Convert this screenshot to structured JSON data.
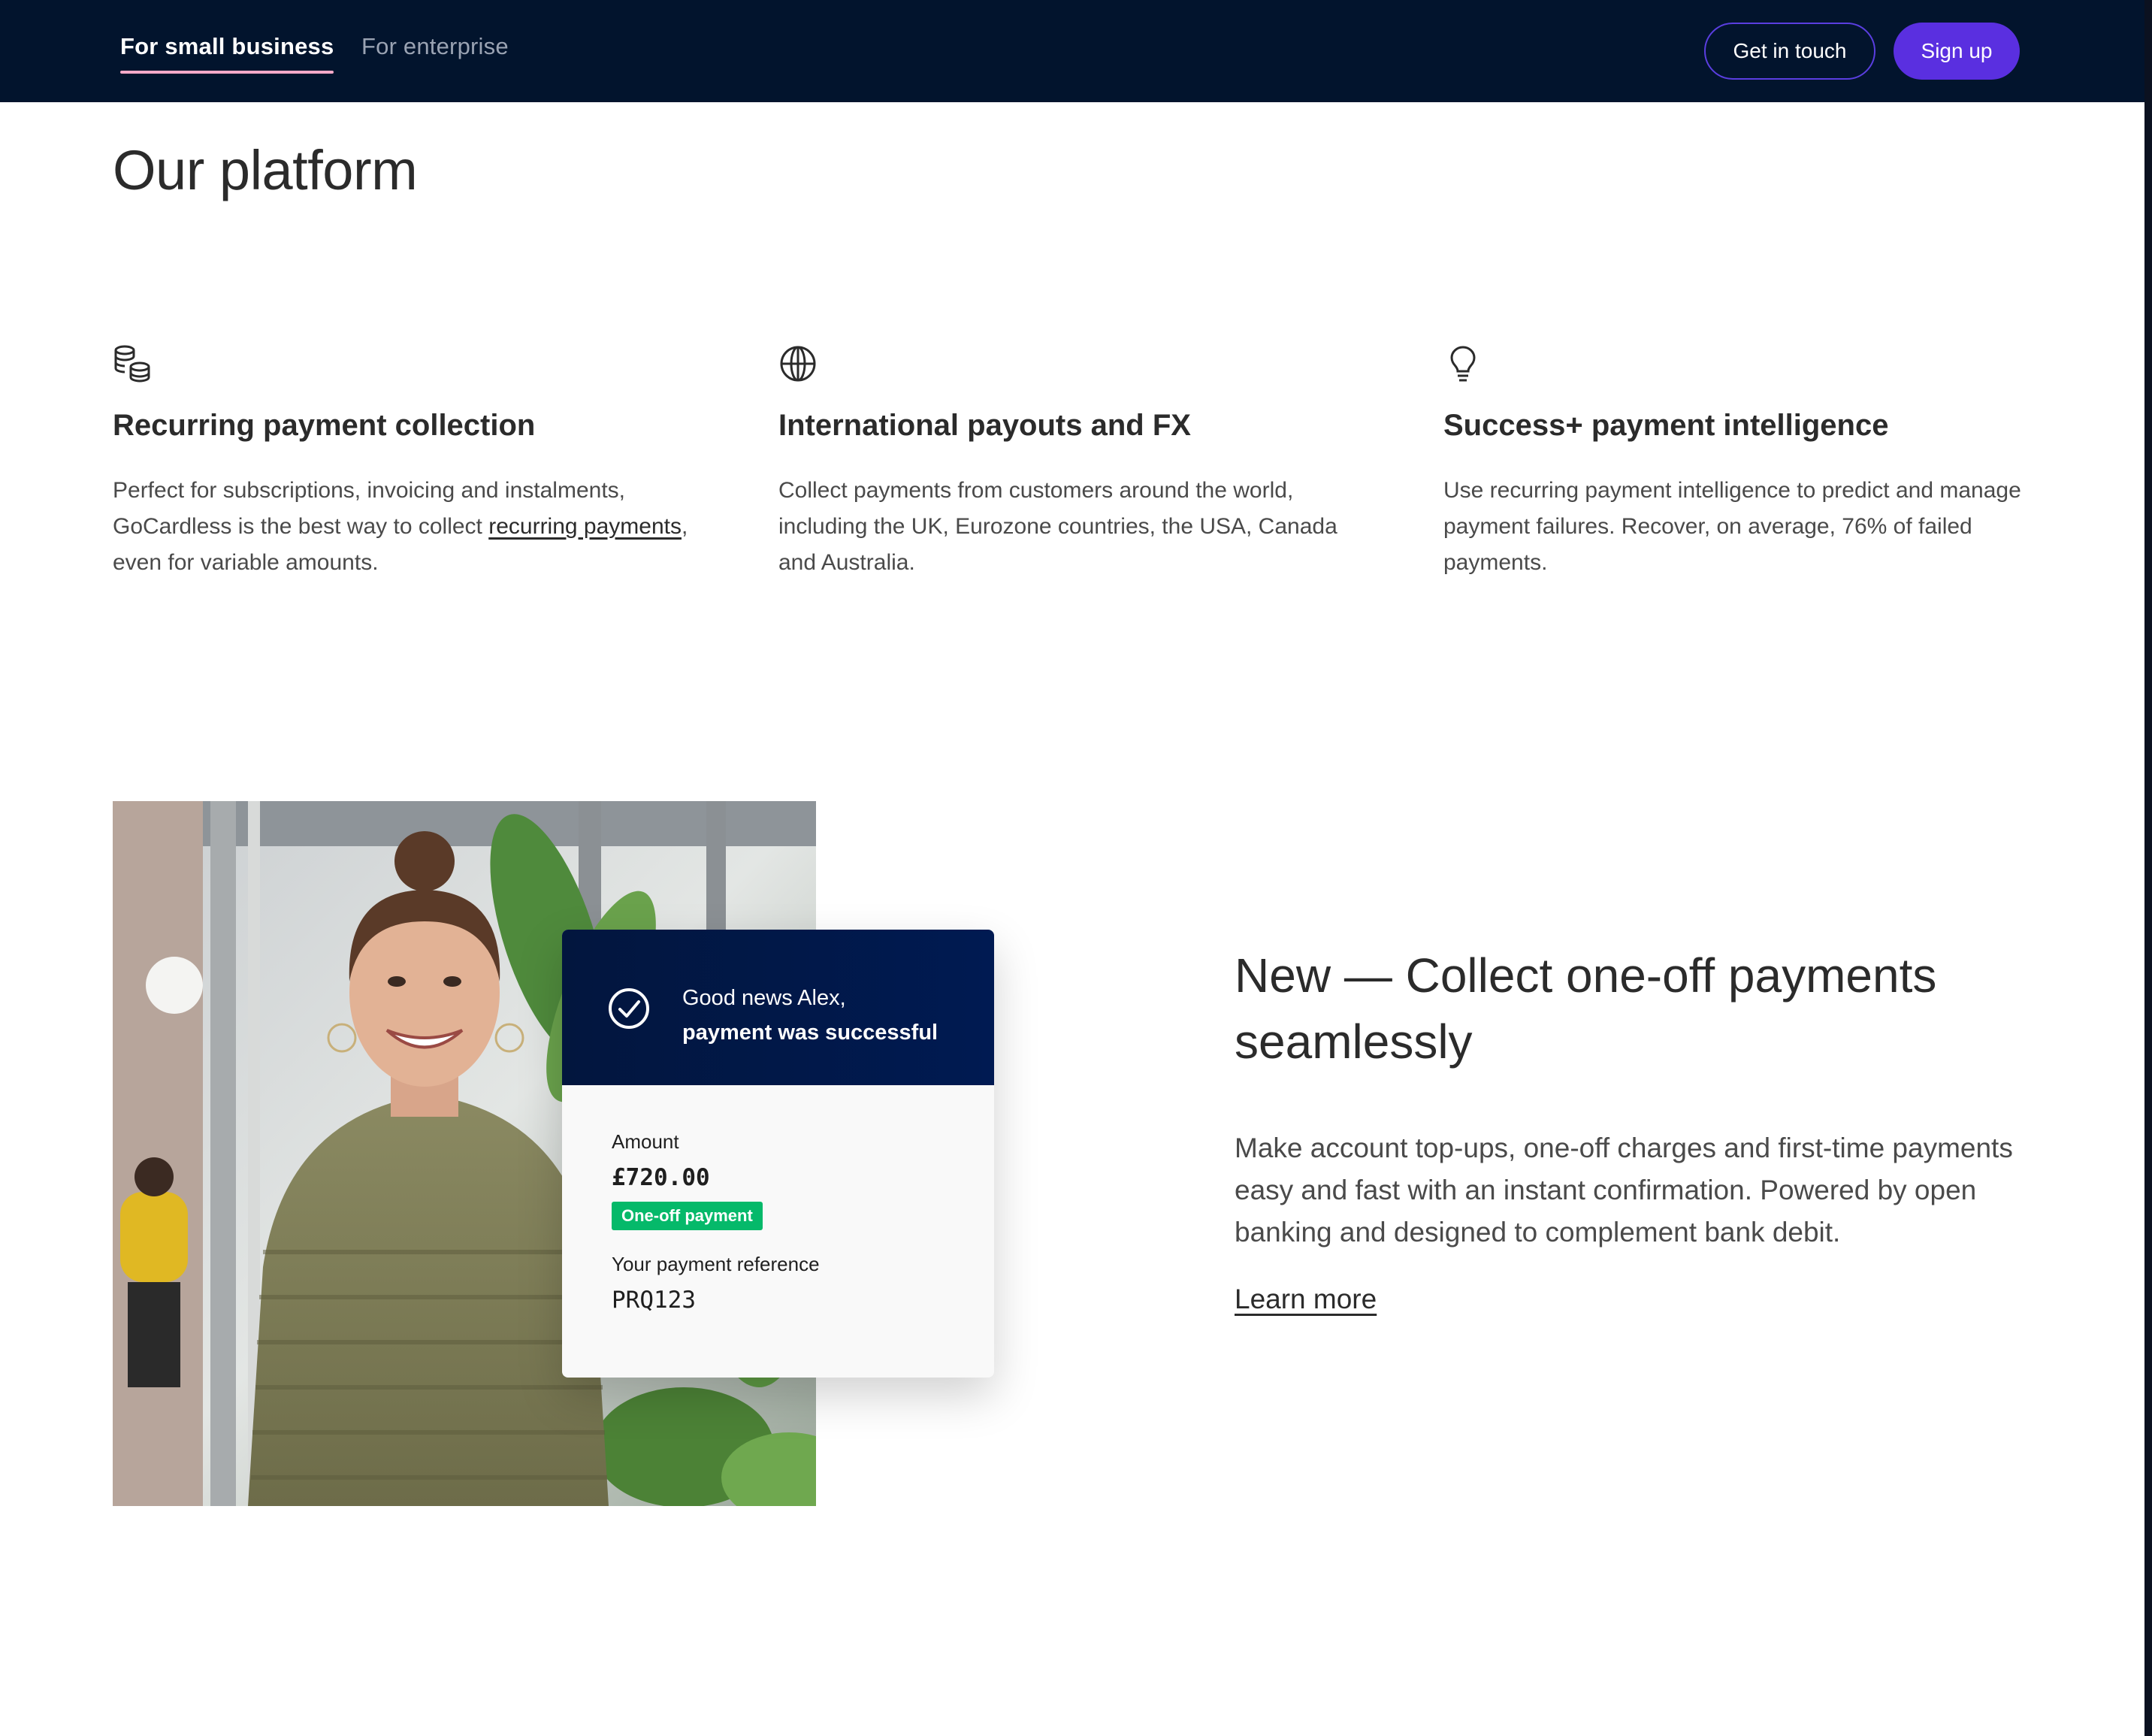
{
  "nav": {
    "tabs": [
      {
        "label": "For small business",
        "active": true
      },
      {
        "label": "For enterprise",
        "active": false
      }
    ],
    "get_in_touch_label": "Get in touch",
    "sign_up_label": "Sign up"
  },
  "colors": {
    "nav_background": "#02142d",
    "primary_button": "#5a2fe0",
    "active_tab_underline": "#f5a9c8",
    "badge_green": "#05b96a",
    "card_header": "#001a4a"
  },
  "platform": {
    "title": "Our platform",
    "features": [
      {
        "icon": "coins-icon",
        "title": "Recurring payment collection",
        "text_before": "Perfect for subscriptions, invoicing and instalments, GoCardless is the best way to collect ",
        "link_text": "recurring payments",
        "text_after": ", even for variable amounts."
      },
      {
        "icon": "globe-icon",
        "title": "International payouts and FX",
        "text": "Collect payments from customers around the world, including the UK, Eurozone countries, the USA, Canada and Australia."
      },
      {
        "icon": "lightbulb-icon",
        "title": "Success+ payment intelligence",
        "text": "Use recurring payment intelligence to predict and manage payment failures. Recover, on average, 76% of failed payments."
      }
    ]
  },
  "payment_card": {
    "greeting_line1": "Good news Alex,",
    "greeting_line2": "payment was successful",
    "amount_label": "Amount",
    "amount_value": "£720.00",
    "badge": "One-off payment",
    "reference_label": "Your payment reference",
    "reference_value": "PRQ123"
  },
  "promo": {
    "title": "New — Collect one-off payments seamlessly",
    "text": "Make account top-ups, one-off charges and first-time payments easy and fast with an instant confirmation. Powered by open banking and designed to complement bank debit.",
    "link_label": "Learn more"
  }
}
